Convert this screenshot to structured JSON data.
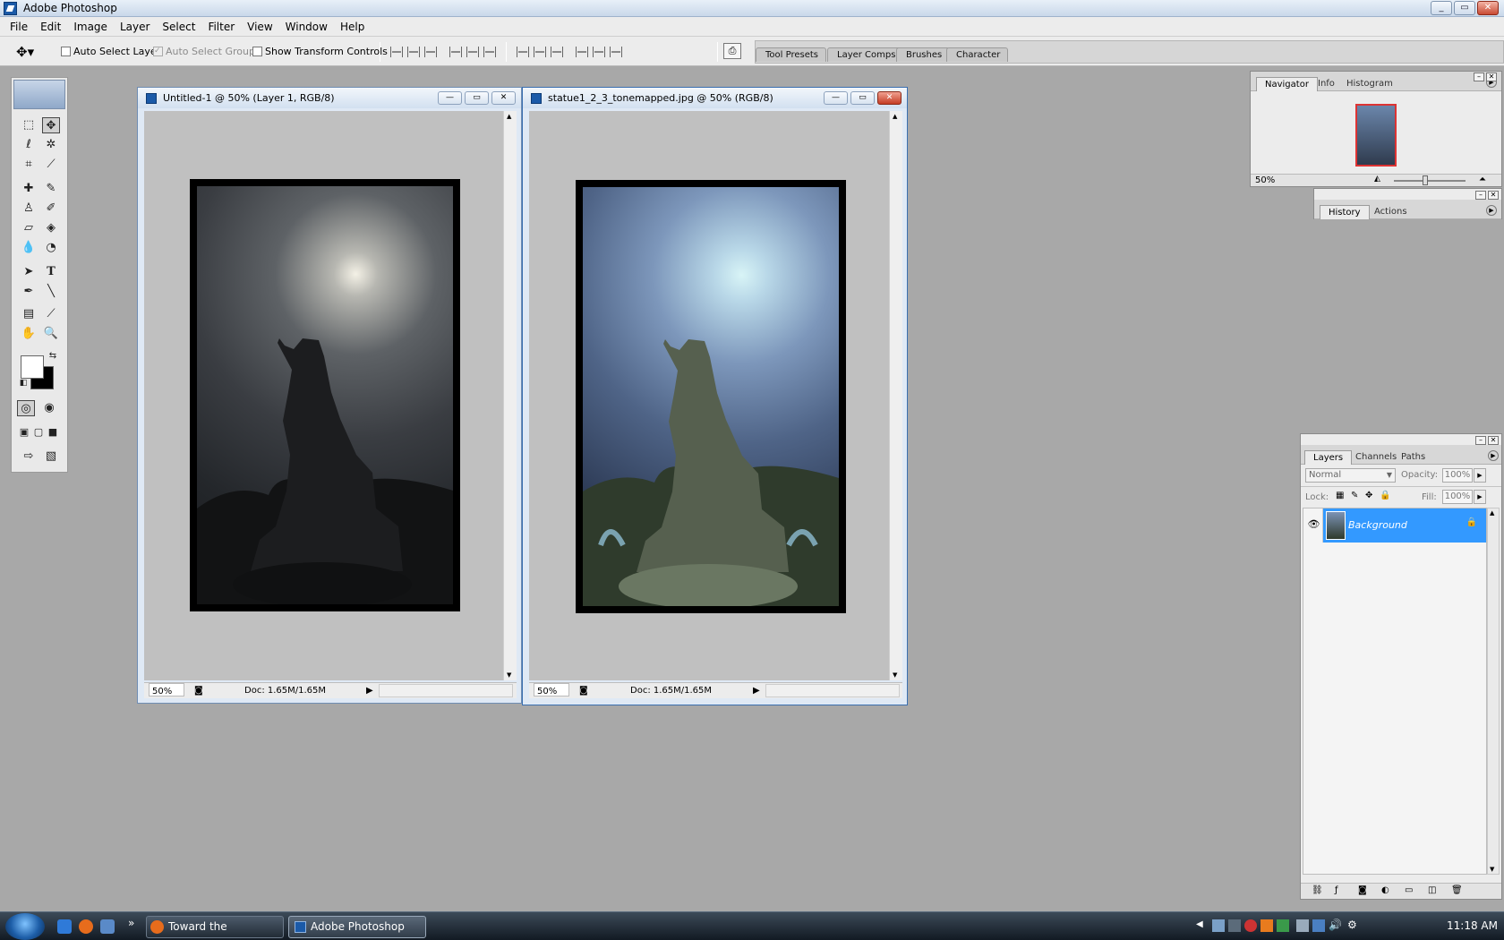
{
  "app": {
    "title": "Adobe Photoshop",
    "window_buttons": [
      "_",
      "▭",
      "✕"
    ]
  },
  "menu": [
    "File",
    "Edit",
    "Image",
    "Layer",
    "Select",
    "Filter",
    "View",
    "Window",
    "Help"
  ],
  "options_bar": {
    "auto_select_layer": "Auto Select Layer",
    "auto_select_groups": "Auto Select Groups",
    "show_transform_controls": "Show Transform Controls",
    "auto_select_layer_checked": false,
    "auto_select_groups_checked": true,
    "show_transform_controls_checked": false
  },
  "palette_well": {
    "tabs": [
      "Tool Presets",
      "Layer Comps",
      "Brushes",
      "Character"
    ]
  },
  "documents": [
    {
      "title": "Untitled-1 @ 50% (Layer 1, RGB/8)",
      "zoom": "50%",
      "doc_size": "Doc: 1.65M/1.65M",
      "active": false
    },
    {
      "title": "statue1_2_3_tonemapped.jpg @ 50% (RGB/8)",
      "zoom": "50%",
      "doc_size": "Doc: 1.65M/1.65M",
      "active": true
    }
  ],
  "navigator": {
    "tabs": [
      "Navigator",
      "Info",
      "Histogram"
    ],
    "zoom": "50%"
  },
  "history": {
    "tabs": [
      "History",
      "Actions"
    ]
  },
  "layers": {
    "tabs": [
      "Layers",
      "Channels",
      "Paths"
    ],
    "blend_mode": "Normal",
    "opacity_label": "Opacity:",
    "opacity": "100%",
    "lock_label": "Lock:",
    "fill_label": "Fill:",
    "fill": "100%",
    "layer_name": "Background"
  },
  "taskbar": {
    "items": [
      {
        "label": "Toward the enlighte...",
        "active": false
      },
      {
        "label": "Adobe Photoshop",
        "active": true
      }
    ],
    "clock": "11:18 AM",
    "chevron": "»"
  },
  "colors": {
    "accent": "#3399ff",
    "workspace": "#a8a8a8"
  }
}
